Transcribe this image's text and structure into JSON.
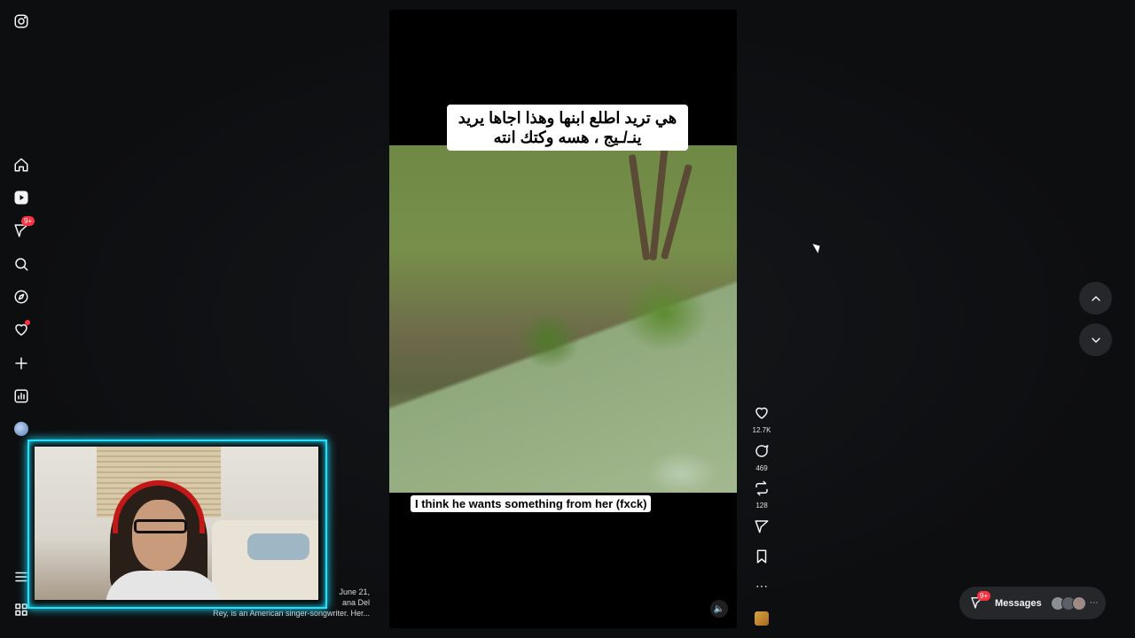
{
  "reel": {
    "caption_top": "هي تريد اطلع ابنها وهذا اجاها يريد ينـ/ـيج ، هسه وكتك انته",
    "caption_bottom": "I think he wants something from her (fxck)"
  },
  "actions": {
    "like_count": "12.7K",
    "comment_count": "469",
    "repost_count": "128"
  },
  "sidebar": {
    "notifications_badge": "9+"
  },
  "messages": {
    "label": "Messages",
    "badge": "9+"
  },
  "background_text": {
    "line1": "June 21,",
    "line2": "ana Del",
    "line3": "Rey, is an American singer-songwriter. Her..."
  },
  "icons": [
    "instagram-icon",
    "home-icon",
    "reels-icon",
    "send-icon",
    "search-icon",
    "explore-icon",
    "heart-icon",
    "plus-icon",
    "dashboard-icon",
    "menu-icon",
    "apps-icon",
    "comment-icon",
    "repost-icon",
    "bookmark-icon",
    "more-icon",
    "speaker-icon",
    "chevron-up-icon",
    "chevron-down-icon"
  ],
  "colors": {
    "background": "#0f1012",
    "accent_badge": "#ff3040",
    "webcam_border": "#22e0ff"
  }
}
